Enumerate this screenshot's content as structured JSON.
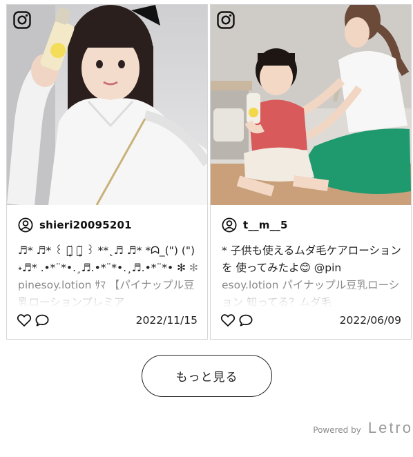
{
  "posts": [
    {
      "username": "shieri20095201",
      "caption_main": "♬* ♬* ꒰ ఠ̥̆ ఠ̥̆ ꒱ **˛♬ ♬* *ᗣ_(\") (\")˖♬* .•*¨*•.¸♬.•*¨*•.¸♬.•*¨*• ✻",
      "caption_cont": "✻ pinesoy.lotion ｻﾏ 【パイナップル豆乳ローションプレミア",
      "date": "2022/11/15",
      "source_icon": "instagram-icon"
    },
    {
      "username": "t__m__5",
      "caption_main": "* 子供も使えるムダ毛ケアローションを 使ってみたよ😊 @pin",
      "caption_cont": "esoy.lotion パイナップル豆乳ローション 知ってる？ムダ毛",
      "date": "2022/06/09",
      "source_icon": "instagram-icon"
    }
  ],
  "more_button": {
    "label": "もっと見る"
  },
  "footer": {
    "powered_by": "Powered by",
    "brand": "Letro"
  },
  "colors": {
    "text": "#222222",
    "muted": "#8a8a8a",
    "border": "#d6d6d6",
    "pants": "#1f9a6e"
  }
}
